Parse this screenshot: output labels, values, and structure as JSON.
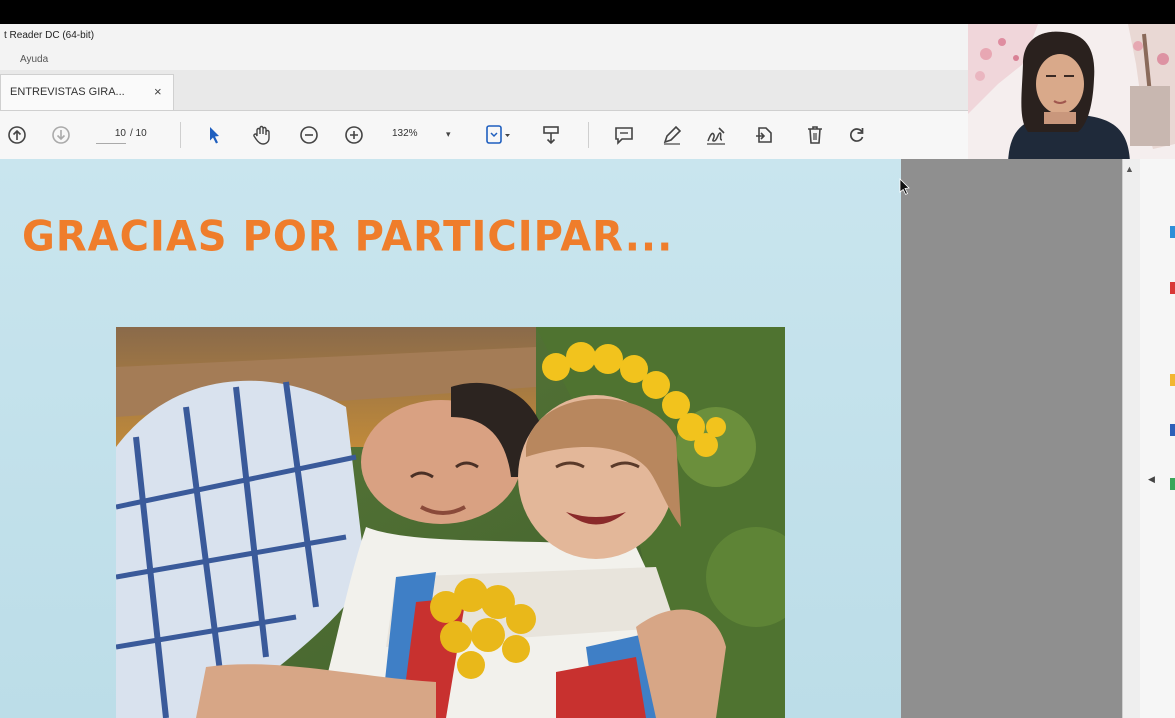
{
  "window": {
    "title": "t Reader DC (64-bit)",
    "menu_help": "Ayuda"
  },
  "tab": {
    "label": "ENTREVISTAS GIRA...",
    "close_symbol": "×"
  },
  "toolbar": {
    "page_current": "10",
    "page_total": "/ 10",
    "zoom": "132%",
    "zoom_arrow": "▾",
    "icons": [
      "page-up-icon",
      "page-down-icon",
      "select-arrow-icon",
      "hand-tool-icon",
      "zoom-out-icon",
      "zoom-in-icon",
      "fit-page-icon",
      "highlight-tool-icon",
      "comment-icon",
      "pen-icon",
      "sign-icon",
      "share-icon",
      "delete-icon",
      "rotate-icon"
    ]
  },
  "slide": {
    "title": "GRACIAS POR PARTICIPAR..."
  },
  "scrollbar": {
    "up_arrow": "▲",
    "collapse_arrow": "◀"
  },
  "colors": {
    "slide_background": "#c4e2ec",
    "title_orange": "#ef7d2b",
    "side_gray": "#8f8f8f"
  }
}
